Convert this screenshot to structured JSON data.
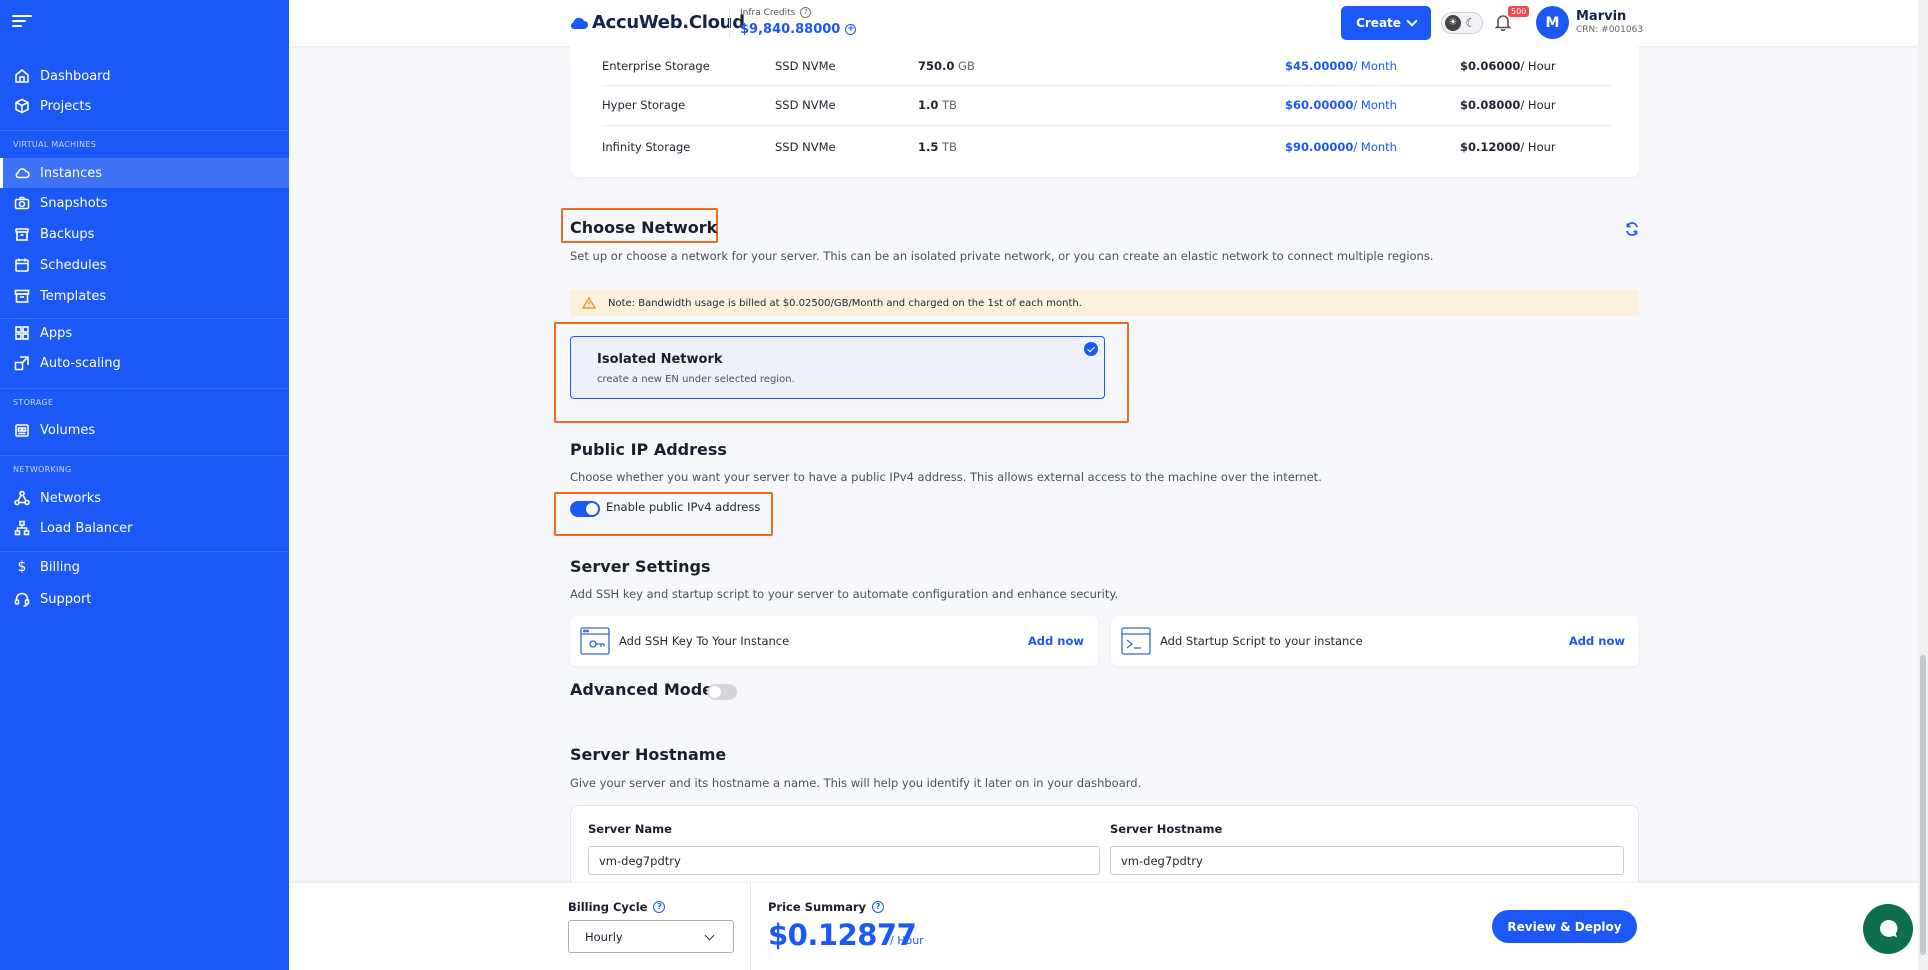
{
  "sidebar": {
    "items": [
      {
        "label": "Dashboard",
        "icon": "home-icon"
      },
      {
        "label": "Projects",
        "icon": "cube-icon"
      },
      {
        "label": "Instances",
        "icon": "cloud-icon"
      },
      {
        "label": "Snapshots",
        "icon": "camera-icon"
      },
      {
        "label": "Backups",
        "icon": "archive-icon"
      },
      {
        "label": "Schedules",
        "icon": "calendar-icon"
      },
      {
        "label": "Templates",
        "icon": "box-icon"
      },
      {
        "label": "Apps",
        "icon": "grid-icon"
      },
      {
        "label": "Auto-scaling",
        "icon": "scale-icon"
      },
      {
        "label": "Volumes",
        "icon": "volume-icon"
      },
      {
        "label": "Networks",
        "icon": "network-icon"
      },
      {
        "label": "Load Balancer",
        "icon": "load-balancer-icon"
      },
      {
        "label": "Billing",
        "icon": "dollar-icon"
      },
      {
        "label": "Support",
        "icon": "headset-icon"
      }
    ],
    "sections": {
      "virtual_machines": "VIRTUAL MACHINES",
      "storage": "STORAGE",
      "networking": "NETWORKING"
    },
    "active": "Instances"
  },
  "header": {
    "logo": "AccuWeb.Cloud",
    "credits_label": "Infra Credits",
    "credits_value": "$9,840.88000",
    "create_label": "Create",
    "notification_count": "500",
    "avatar_initial": "M",
    "user_name": "Marvin",
    "user_crn": "CRN: #001063"
  },
  "storage_table": [
    {
      "name": "Enterprise Storage",
      "type": "SSD NVMe",
      "size": "750.0",
      "unit": "GB",
      "monthly": "$45.00000",
      "monthly_suffix": "/ Month",
      "hourly": "$0.06000",
      "hourly_suffix": "/ Hour"
    },
    {
      "name": "Hyper Storage",
      "type": "SSD NVMe",
      "size": "1.0",
      "unit": "TB",
      "monthly": "$60.00000",
      "monthly_suffix": "/ Month",
      "hourly": "$0.08000",
      "hourly_suffix": "/ Hour"
    },
    {
      "name": "Infinity Storage",
      "type": "SSD NVMe",
      "size": "1.5",
      "unit": "TB",
      "monthly": "$90.00000",
      "monthly_suffix": "/ Month",
      "hourly": "$0.12000",
      "hourly_suffix": "/ Hour"
    }
  ],
  "network": {
    "title": "Choose Network",
    "description": "Set up or choose a network for your server. This can be an isolated private network, or you can create an elastic network to connect multiple regions.",
    "note": "Note: Bandwidth usage is billed at $0.02500/GB/Month and charged on the 1st of each month.",
    "option_title": "Isolated Network",
    "option_desc": "create a new EN under selected region."
  },
  "public_ip": {
    "title": "Public IP Address",
    "description": "Choose whether you want your server to have a public IPv4 address. This allows external access to the machine over the internet.",
    "toggle_label": "Enable public IPv4 address",
    "enabled": true
  },
  "server_settings": {
    "title": "Server Settings",
    "description": "Add SSH key and startup script to your server to automate configuration and enhance security.",
    "ssh_label": "Add SSH Key To Your Instance",
    "ssh_action": "Add now",
    "script_label": "Add Startup Script to your instance",
    "script_action": "Add now"
  },
  "advanced_mode": {
    "label": "Advanced Mode",
    "enabled": false
  },
  "hostname": {
    "title": "Server Hostname",
    "description": "Give your server and its hostname a name. This will help you identify it later on in your dashboard.",
    "name_label": "Server Name",
    "name_value": "vm-deg7pdtry",
    "host_label": "Server Hostname",
    "host_value": "vm-deg7pdtry"
  },
  "footer": {
    "billing_label": "Billing Cycle",
    "billing_value": "Hourly",
    "price_label": "Price Summary",
    "price_value": "$0.12877",
    "price_unit": "/ Hour",
    "deploy_label": "Review & Deploy"
  },
  "colors": {
    "primary": "#1b58f5",
    "highlight": "#f36a1c",
    "note_bg": "#fdf1dc"
  }
}
